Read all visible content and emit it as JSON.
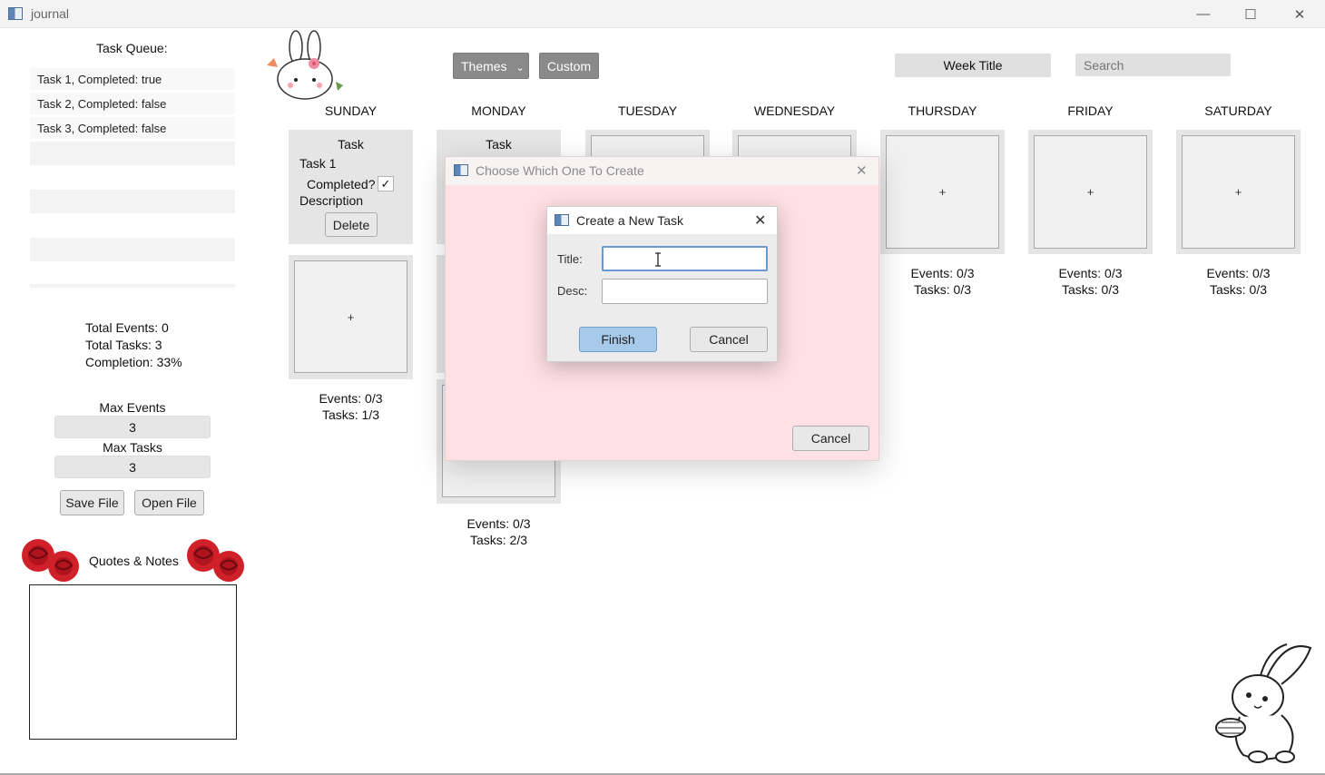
{
  "window": {
    "title": "journal",
    "minimize_glyph": "—",
    "maximize_glyph": "☐",
    "close_glyph": "✕"
  },
  "sidebar": {
    "queue_title": "Task Queue:",
    "queue_items": [
      "Task 1, Completed: true",
      "Task 2, Completed: false",
      "Task 3, Completed: false"
    ],
    "stats": {
      "total_events": "Total Events: 0",
      "total_tasks": "Total Tasks: 3",
      "completion": "Completion: 33%"
    },
    "max_events_label": "Max Events",
    "max_events_value": "3",
    "max_tasks_label": "Max Tasks",
    "max_tasks_value": "3",
    "save_label": "Save File",
    "open_label": "Open File",
    "notes_label": "Quotes & Notes"
  },
  "toolbar": {
    "themes_label": "Themes",
    "themes_arrow": "⌄",
    "custom_label": "Custom",
    "week_title": "Week Title",
    "search_placeholder": "Search"
  },
  "days": [
    {
      "name": "SUNDAY",
      "events": "Events: 0/3",
      "tasks": "Tasks: 1/3"
    },
    {
      "name": "MONDAY",
      "events": "Events: 0/3",
      "tasks": "Tasks: 2/3"
    },
    {
      "name": "TUESDAY"
    },
    {
      "name": "WEDNESDAY"
    },
    {
      "name": "THURSDAY",
      "events": "Events: 0/3",
      "tasks": "Tasks: 0/3"
    },
    {
      "name": "FRIDAY",
      "events": "Events: 0/3",
      "tasks": "Tasks: 0/3"
    },
    {
      "name": "SATURDAY",
      "events": "Events: 0/3",
      "tasks": "Tasks: 0/3"
    }
  ],
  "sunday_task_card": {
    "header": "Task",
    "title": "Task 1",
    "completed_label": "Completed?",
    "checkmark": "✓",
    "description_label": "Description",
    "delete_label": "Delete"
  },
  "monday_card_header": "Task",
  "plus": "+",
  "choose_dialog": {
    "title": "Choose Which One To Create",
    "close_glyph": "✕",
    "cancel_label": "Cancel"
  },
  "create_task_dialog": {
    "title": "Create a New Task",
    "close_glyph": "✕",
    "title_label": "Title:",
    "title_value": "",
    "desc_label": "Desc:",
    "desc_value": "",
    "finish_label": "Finish",
    "cancel_label": "Cancel"
  }
}
